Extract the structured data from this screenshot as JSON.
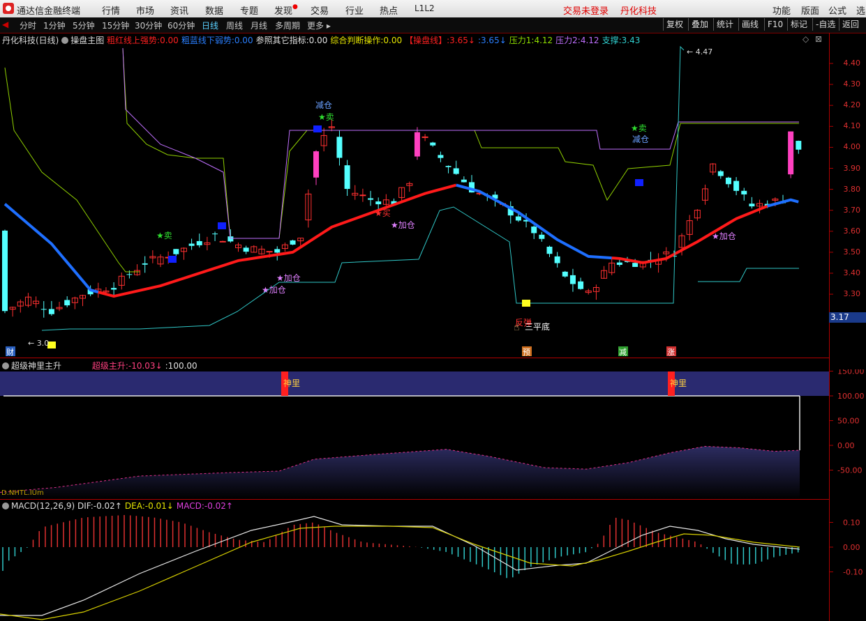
{
  "app": {
    "name": "通达信金融终端",
    "menus": [
      "行情",
      "市场",
      "资讯",
      "数据",
      "专题",
      "发现",
      "交易",
      "行业",
      "热点",
      "L1L2"
    ],
    "login_status": "交易未登录",
    "stock_name": "丹化科技",
    "right_menus": [
      "功能",
      "版面",
      "公式",
      "选"
    ]
  },
  "toolbar": {
    "periods": [
      "分时",
      "1分钟",
      "5分钟",
      "15分钟",
      "30分钟",
      "60分钟",
      "日线",
      "周线",
      "月线",
      "多周期",
      "更多"
    ],
    "active_period": "日线",
    "right_buttons": [
      "复权",
      "叠加",
      "统计",
      "画线",
      "F10",
      "标记",
      "-自选",
      "返回"
    ]
  },
  "main_panel": {
    "title": "丹化科技(日线)",
    "indicator": "操盘主图",
    "legend": [
      {
        "label": "粗红线上强势:",
        "value": "0.00",
        "color": "#ff2020"
      },
      {
        "label": "粗蓝线下弱势:",
        "value": "0.00",
        "color": "#2a7fff"
      },
      {
        "label": "参照其它指标:",
        "value": "0.00",
        "color": "#e0e0e0"
      },
      {
        "label": "综合判断操作:",
        "value": "0.00",
        "color": "#e6e600"
      },
      {
        "label": "【操盘线】:",
        "value": "3.65↓",
        "color": "#ff2020"
      },
      {
        "label": ":",
        "value": "3.65↓",
        "color": "#2a7fff"
      },
      {
        "label": "压力1:",
        "value": "4.12",
        "color": "#90e000"
      },
      {
        "label": "压力2:",
        "value": "4.12",
        "color": "#c070ff"
      },
      {
        "label": "支撑:",
        "value": "3.43",
        "color": "#30d0d0"
      }
    ],
    "y_ticks": [
      "4.40",
      "4.30",
      "4.20",
      "4.10",
      "4.00",
      "3.90",
      "3.80",
      "3.70",
      "3.60",
      "3.50",
      "3.40",
      "3.30"
    ],
    "current_price": "3.17",
    "high_mark": "4.47",
    "low_mark": "3.0",
    "annotations": [
      {
        "text": "减仓",
        "color": "#6aa0ff"
      },
      {
        "text": "★卖",
        "color": "#30e030"
      },
      {
        "text": "★卖",
        "color": "#30e030"
      },
      {
        "text": "★卖",
        "color": "#30e030"
      },
      {
        "text": "减仓",
        "color": "#6aa0ff"
      },
      {
        "text": "★买",
        "color": "#ff3030"
      },
      {
        "text": "★加仓",
        "color": "#e080ff"
      },
      {
        "text": "★加仓",
        "color": "#e080ff"
      },
      {
        "text": "★加仓",
        "color": "#e080ff"
      },
      {
        "text": "★加仓",
        "color": "#e080ff"
      },
      {
        "text": "反弹",
        "color": "#ff3030"
      },
      {
        "text": "三平底",
        "color": "#ffffff"
      }
    ],
    "bottom_markers": [
      {
        "text": "财",
        "color": "#2a60c0"
      },
      {
        "text": "预",
        "color": "#d07020"
      },
      {
        "text": "减",
        "color": "#30a030"
      },
      {
        "text": "涨",
        "color": "#d03030"
      }
    ]
  },
  "panel2": {
    "title": "超级神里主升",
    "legend": [
      {
        "label": "超级主升:",
        "value": "-10.03↓",
        "color": "#ff4080"
      },
      {
        "label": ":",
        "value": "100.00",
        "color": "#e0e0e0"
      }
    ],
    "y_ticks": [
      "150.00",
      "100.00",
      "50.00",
      "0.00",
      "-50.00"
    ],
    "signal_label": "神里",
    "watermark": "D.NHTL.IUm"
  },
  "panel3": {
    "title": "MACD(12,26,9)",
    "legend": [
      {
        "label": "DIF:",
        "value": "-0.02↑",
        "color": "#e0e0e0"
      },
      {
        "label": "DEA:",
        "value": "-0.01↓",
        "color": "#e6e600"
      },
      {
        "label": "MACD:",
        "value": "-0.02↑",
        "color": "#e040e0"
      }
    ],
    "y_ticks": [
      "0.10",
      "0.00",
      "-0.10"
    ]
  }
}
